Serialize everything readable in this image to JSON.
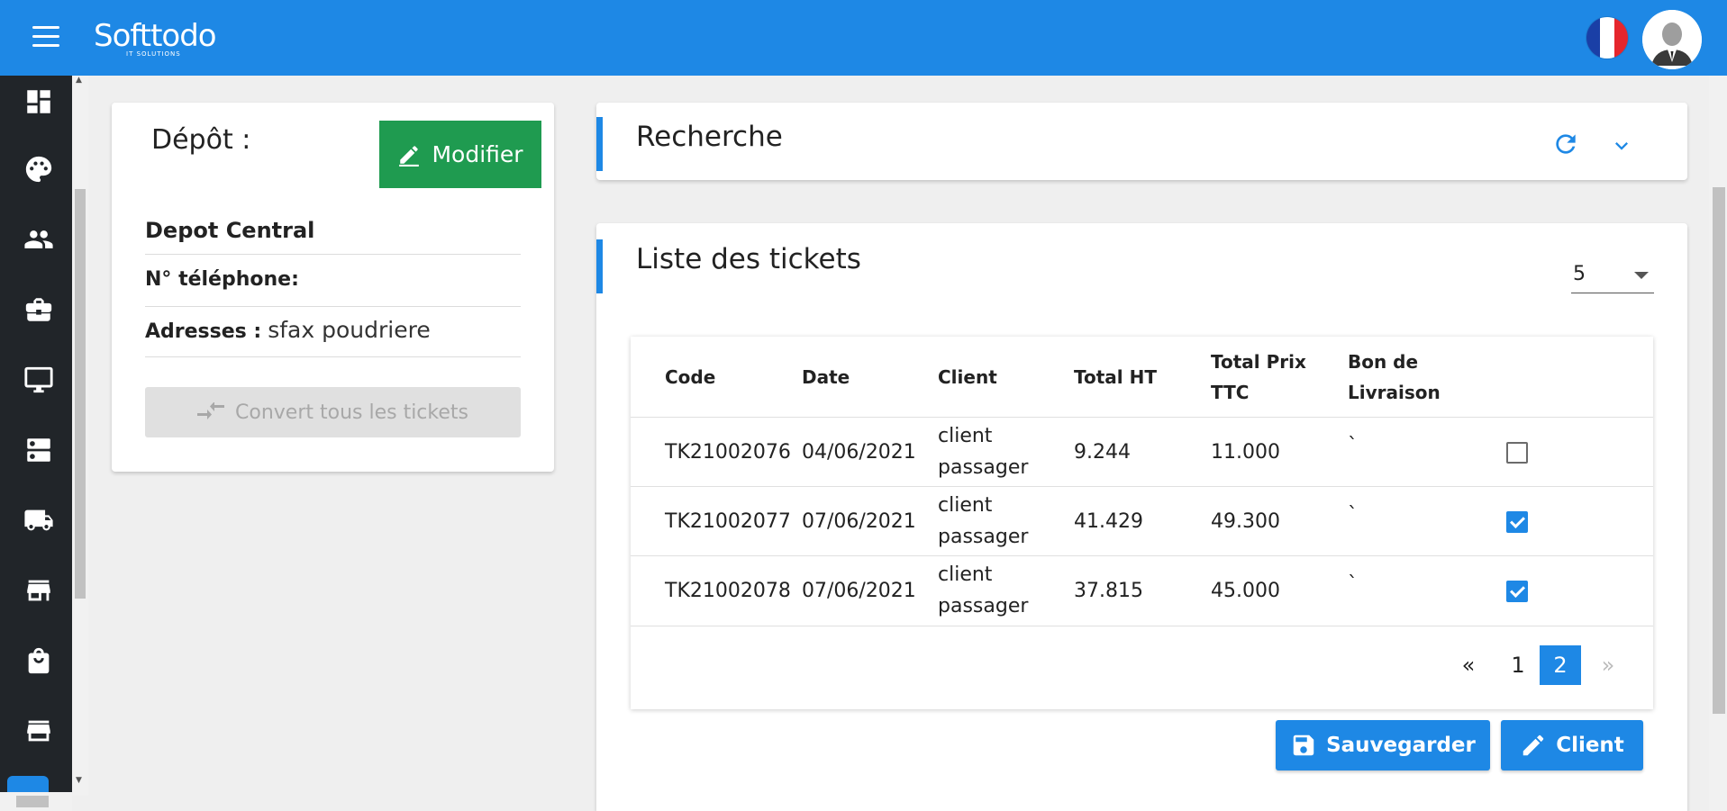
{
  "header": {
    "logo_text": "Softtodo",
    "logo_sub": "IT SOLUTIONS",
    "flag_colors": [
      "#1a3fa6",
      "#ffffff",
      "#e5262d"
    ]
  },
  "sidebar": {
    "items": [
      {
        "icon": "dashboard-icon"
      },
      {
        "icon": "palette-icon"
      },
      {
        "icon": "users-icon"
      },
      {
        "icon": "briefcase-icon"
      },
      {
        "icon": "monitor-icon"
      },
      {
        "icon": "server-icon"
      },
      {
        "icon": "truck-icon"
      },
      {
        "icon": "store-icon"
      },
      {
        "icon": "shopping-bag-icon"
      },
      {
        "icon": "shop-icon"
      }
    ]
  },
  "depot": {
    "title": "Dépôt :",
    "modify_label": "Modifier",
    "name": "Depot Central",
    "phone_label": "N° téléphone:",
    "phone_value": "",
    "address_label": "Adresses :",
    "address_value": "sfax poudriere",
    "convert_label": "Convert tous les tickets"
  },
  "search": {
    "title": "Recherche"
  },
  "tickets": {
    "title": "Liste des tickets",
    "per_page": "5",
    "columns": [
      "Code",
      "Date",
      "Client",
      "Total HT",
      "Total Prix TTC",
      "Bon de Livraison"
    ],
    "rows": [
      {
        "code": "TK21002076",
        "date": "04/06/2021",
        "client": "client passager",
        "total_ht": "9.244",
        "total_ttc": "11.000",
        "bon": "`",
        "checked": false
      },
      {
        "code": "TK21002077",
        "date": "07/06/2021",
        "client": "client passager",
        "total_ht": "41.429",
        "total_ttc": "49.300",
        "bon": "`",
        "checked": true
      },
      {
        "code": "TK21002078",
        "date": "07/06/2021",
        "client": "client passager",
        "total_ht": "37.815",
        "total_ttc": "45.000",
        "bon": "`",
        "checked": true
      }
    ],
    "pagination": {
      "prev": "«",
      "pages": [
        "1",
        "2"
      ],
      "current": "2",
      "next": "»"
    },
    "save_label": "Sauvegarder",
    "client_label": "Client"
  },
  "colors": {
    "primary": "#1e88e5",
    "success": "#1f9b50",
    "sidebar": "#212529"
  }
}
